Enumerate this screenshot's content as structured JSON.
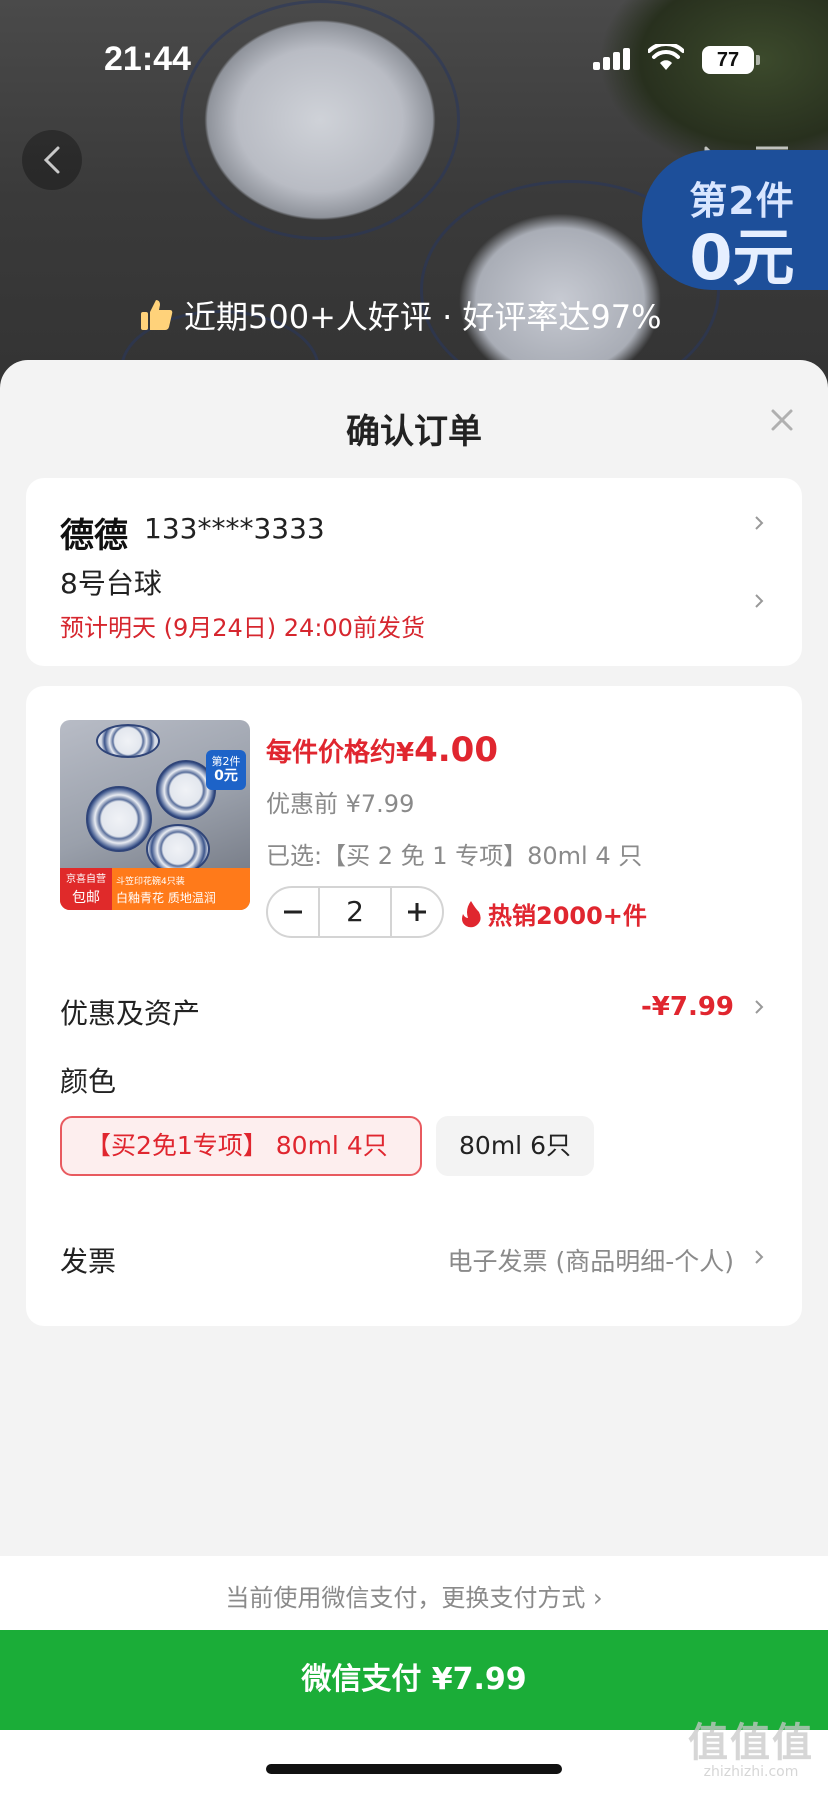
{
  "status_bar": {
    "time": "21:44",
    "battery": "77"
  },
  "hero": {
    "promo_badge": {
      "line1": "第2件",
      "line2": "0元"
    },
    "review_text": "近期500+人好评 · 好评率达97%"
  },
  "sheet": {
    "title": "确认订单"
  },
  "address": {
    "name": "德德",
    "phone": "133****3333",
    "detail": "8号台球",
    "shipping": "预计明天 (9月24日) 24:00前发货"
  },
  "product": {
    "thumb": {
      "badge_top": "第2件",
      "badge_bottom": "0元",
      "strip_left_top": "京喜自营",
      "strip_left_bottom": "包邮",
      "strip_text_top": "斗笠印花碗4只装",
      "strip_text_bottom": "白釉青花 质地温润"
    },
    "price_prefix": "每件价格约",
    "price_symbol": "¥",
    "price_value": "4.00",
    "original_price": "优惠前 ¥7.99",
    "selected_spec": "已选:【买 2 免 1 专项】80ml 4 只",
    "quantity": "2",
    "hot_sales": "热销2000+件"
  },
  "rows": {
    "discount_label": "优惠及资产",
    "discount_value": "-¥7.99",
    "color_label": "颜色",
    "color_options": [
      "【买2免1专项】 80ml 4只",
      "80ml 6只"
    ],
    "invoice_label": "发票",
    "invoice_value": "电子发票 (商品明细-个人)"
  },
  "payment": {
    "switch_text": "当前使用微信支付，更换支付方式 ›",
    "pay_button": "微信支付 ¥7.99"
  },
  "watermark": {
    "line1": "值值值",
    "line2": "zhizhizhi.com"
  },
  "colors": {
    "accent_red": "#e0262f",
    "pay_green": "#1bad38",
    "promo_blue": "#1d4f9a"
  }
}
